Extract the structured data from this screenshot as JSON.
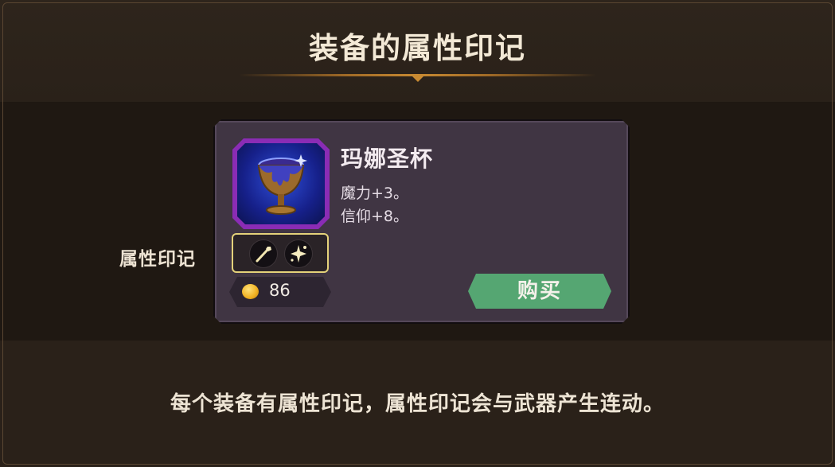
{
  "dialog": {
    "title": "装备的属性印记"
  },
  "side_label": "属性印记",
  "item": {
    "name": "玛娜圣杯",
    "stats": [
      "魔力+3。",
      "信仰+8。"
    ],
    "icon": "chalice-icon",
    "rarity_color": "#8a2cb5",
    "seals": [
      {
        "icon": "wand-seal-icon"
      },
      {
        "icon": "sparkle-seal-icon"
      }
    ],
    "price": "86",
    "currency_icon": "gold-coin-icon",
    "buy_label": "购买",
    "buy_color": "#55a672"
  },
  "hint": "每个装备有属性印记，属性印记会与武器产生连动。"
}
